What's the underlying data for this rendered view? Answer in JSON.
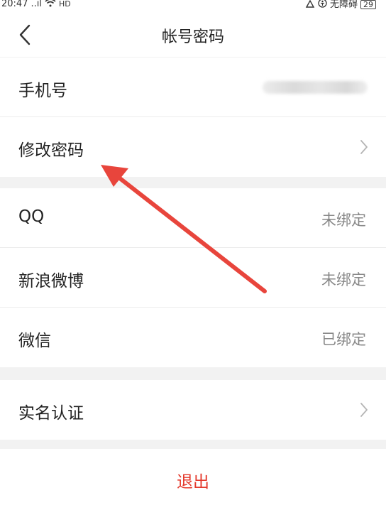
{
  "status_bar": {
    "time": "20:47",
    "signal": "..ıl",
    "network": "HD",
    "accessibility": "无障碍",
    "battery": "29"
  },
  "header": {
    "title": "帐号密码"
  },
  "account_group": {
    "phone_label": "手机号",
    "change_password_label": "修改密码"
  },
  "binding_group": {
    "items": [
      {
        "label": "QQ",
        "value": "未绑定"
      },
      {
        "label": "新浪微博",
        "value": "未绑定"
      },
      {
        "label": "微信",
        "value": "已绑定"
      }
    ]
  },
  "verification_group": {
    "real_name_label": "实名认证"
  },
  "logout": {
    "label": "退出",
    "color": "#e4392c"
  },
  "annotation": {
    "arrow_color": "#e8453c"
  },
  "icons": [
    "back-arrow-icon",
    "chevron-right-icon",
    "wifi-icon",
    "battery-icon"
  ]
}
